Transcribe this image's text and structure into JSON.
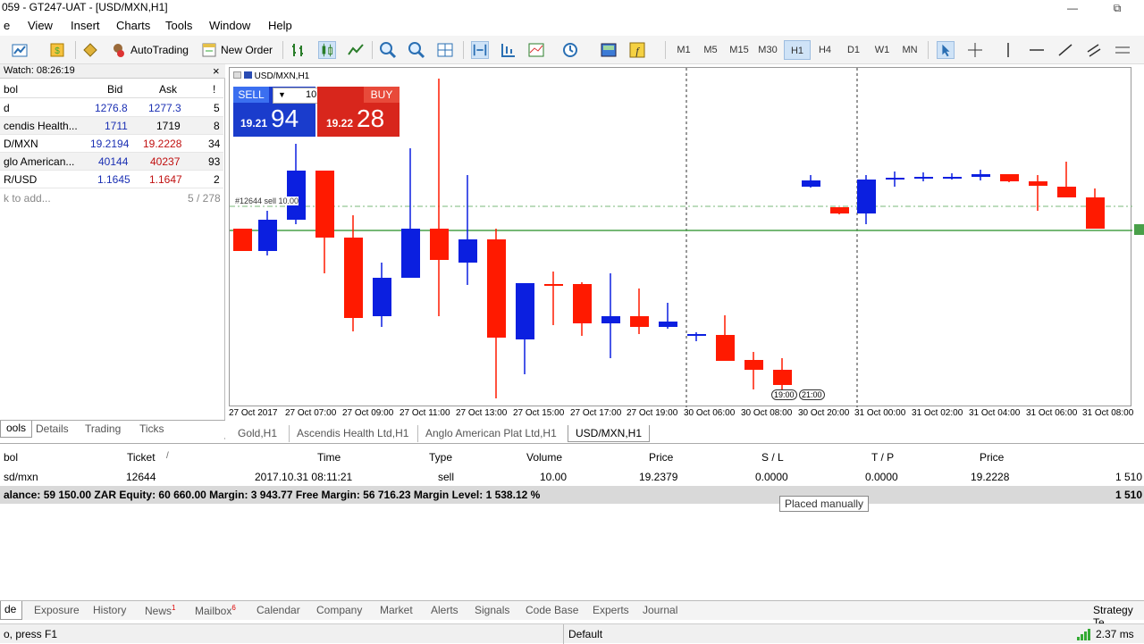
{
  "window": {
    "title": "059 - GT247-UAT - [USD/MXN,H1]",
    "controls": [
      "—",
      "⧉"
    ]
  },
  "menu": [
    "e",
    "View",
    "Insert",
    "Charts",
    "Tools",
    "Window",
    "Help"
  ],
  "toolbar": {
    "autotrading": "AutoTrading",
    "new_order": "New Order",
    "timeframes": [
      "M1",
      "M5",
      "M15",
      "M30",
      "H1",
      "H4",
      "D1",
      "W1",
      "MN"
    ],
    "active_timeframe": "H1"
  },
  "market_watch": {
    "title": "Watch: 08:26:19",
    "close": "×",
    "columns": [
      "bol",
      "Bid",
      "Ask",
      "!"
    ],
    "rows": [
      {
        "symbol": "d",
        "bid": "1276.8",
        "ask": "1277.3",
        "spread": "5"
      },
      {
        "symbol": "cendis Health...",
        "bid": "1711",
        "ask": "1719",
        "spread": "8"
      },
      {
        "symbol": "D/MXN",
        "bid": "19.2194",
        "ask": "19.2228",
        "spread": "34"
      },
      {
        "symbol": "glo American...",
        "bid": "40144",
        "ask": "40237",
        "spread": "93"
      },
      {
        "symbol": "R/USD",
        "bid": "1.1645",
        "ask": "1.1647",
        "spread": "2"
      }
    ],
    "add_text": "k to add...",
    "count": "5 / 278",
    "tabs": [
      "ools",
      "Details",
      "Trading",
      "Ticks"
    ]
  },
  "chart": {
    "symbol_label": "USD/MXN,H1",
    "trade_line_label": "#12644 sell 10.00",
    "one_click": {
      "sell_label": "SELL",
      "buy_label": "BUY",
      "volume": "10.00",
      "sell_price_small": "19.21",
      "sell_price_big": "94",
      "buy_price_small": "19.22",
      "buy_price_big": "28"
    },
    "time_markers": [
      "19:00",
      "21:00"
    ],
    "x_labels": [
      "27 Oct 2017",
      "27 Oct 07:00",
      "27 Oct 09:00",
      "27 Oct 11:00",
      "27 Oct 13:00",
      "27 Oct 15:00",
      "27 Oct 17:00",
      "27 Oct 19:00",
      "30 Oct 06:00",
      "30 Oct 08:00",
      "30 Oct 20:00",
      "31 Oct 00:00",
      "31 Oct 02:00",
      "31 Oct 04:00",
      "31 Oct 06:00",
      "31 Oct 08:00"
    ],
    "tabs": [
      "Gold,H1",
      "Ascendis Health Ltd,H1",
      "Anglo American Plat Ltd,H1",
      "USD/MXN,H1"
    ],
    "active_tab": "USD/MXN,H1",
    "colors": {
      "bull": "#0b1fe0",
      "bear": "#ff1a00",
      "grid": "#999999"
    }
  },
  "chart_data": {
    "type": "candlestick",
    "up_color": "#0b1fe0",
    "down_color": "#ff1a00",
    "candles": [
      {
        "o": 0,
        "c": 0,
        "h": 0,
        "l": 0,
        "dir": "down"
      }
    ]
  },
  "terminal": {
    "columns": [
      "bol",
      "Ticket",
      "Time",
      "Type",
      "Volume",
      "Price",
      "S / L",
      "T / P",
      "Price"
    ],
    "sort_marker": "/",
    "row": {
      "symbol": "sd/mxn",
      "ticket": "12644",
      "time": "2017.10.31 08:11:21",
      "type": "sell",
      "volume": "10.00",
      "price": "19.2379",
      "sl": "0.0000",
      "tp": "0.0000",
      "current": "19.2228",
      "profit": "1 510"
    },
    "balance_line": "alance: 59 150.00 ZAR  Equity: 60 660.00  Margin: 3 943.77  Free Margin: 56 716.23  Margin Level: 1 538.12 %",
    "balance_profit": "1 510",
    "tooltip": "Placed manually",
    "tabs": [
      "de",
      "Exposure",
      "History",
      "News",
      "Mailbox",
      "Calendar",
      "Company",
      "Market",
      "Alerts",
      "Signals",
      "Code Base",
      "Experts",
      "Journal"
    ],
    "news_badge": "1",
    "mailbox_badge": "6",
    "strategy_tester": "Strategy Te"
  },
  "statusbar": {
    "help": "o, press F1",
    "profile": "Default",
    "ping": "2.37 ms"
  }
}
